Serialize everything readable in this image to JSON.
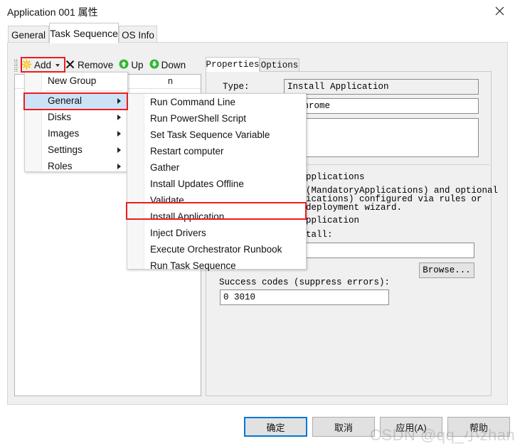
{
  "window": {
    "title": "Application 001 属性",
    "close_icon": "close-icon"
  },
  "tabs": [
    {
      "label": "General",
      "active": false
    },
    {
      "label": "Task Sequence",
      "active": true
    },
    {
      "label": "OS Info",
      "active": false
    }
  ],
  "toolbar": {
    "add_label": "Add",
    "remove_label": "Remove",
    "up_label": "Up",
    "down_label": "Down",
    "add_icon": "starburst-add-icon",
    "remove_icon": "x-remove-icon",
    "up_icon": "green-up-arrow-icon",
    "down_icon": "green-down-arrow-icon"
  },
  "tree": {
    "header_fragment": "n"
  },
  "add_menu": {
    "items": [
      {
        "label": "New Group",
        "submenu": false,
        "selected": false,
        "separator_after": true
      },
      {
        "label": "General",
        "submenu": true,
        "selected": true,
        "separator_after": false
      },
      {
        "label": "Disks",
        "submenu": true,
        "selected": false,
        "separator_after": false
      },
      {
        "label": "Images",
        "submenu": true,
        "selected": false,
        "separator_after": false
      },
      {
        "label": "Settings",
        "submenu": true,
        "selected": false,
        "separator_after": false
      },
      {
        "label": "Roles",
        "submenu": true,
        "selected": false,
        "separator_after": false
      }
    ]
  },
  "general_submenu": {
    "items": [
      {
        "label": "Run Command Line",
        "highlighted": false
      },
      {
        "label": "Run PowerShell Script",
        "highlighted": false
      },
      {
        "label": "Set Task Sequence Variable",
        "highlighted": false
      },
      {
        "label": "Restart computer",
        "highlighted": false
      },
      {
        "label": "Gather",
        "highlighted": false
      },
      {
        "label": "Install Updates Offline",
        "highlighted": false
      },
      {
        "label": "Validate",
        "highlighted": false
      },
      {
        "label": "Install Application",
        "highlighted": true
      },
      {
        "label": "Inject Drivers",
        "highlighted": false
      },
      {
        "label": "Execute Orchestrator Runbook",
        "highlighted": false
      },
      {
        "label": "Run Task Sequence",
        "highlighted": false
      }
    ]
  },
  "properties": {
    "tabs": [
      {
        "label": "Properties",
        "active": true
      },
      {
        "label": "Options",
        "active": false
      }
    ],
    "type_label": "Type:",
    "type_value": "Install Application",
    "name_value": "l Chrome",
    "description_value": "",
    "radio_install_multiple": "pplications",
    "radio_install_multiple_note_1": "(MandatoryApplications) and optional",
    "radio_install_multiple_note_2": "ications) configured via rules or",
    "radio_install_multiple_note_3": "deployment wizard.",
    "radio_install_single": "pplication",
    "app_to_install_label": "tall:",
    "app_to_install_value": "",
    "browse_label": "Browse...",
    "success_codes_label": "Success codes (suppress errors):",
    "success_codes_value": "0 3010"
  },
  "footer": {
    "ok": "确定",
    "cancel": "取消",
    "apply": "应用(A)",
    "help": "帮助"
  },
  "watermark": "CSDN @qq_小zhang",
  "colors": {
    "accent": "#0078d7",
    "annotation_red": "#ee1c1c",
    "menu_select_blue": "#cce3f7",
    "panel_gray": "#f0f0f0"
  }
}
